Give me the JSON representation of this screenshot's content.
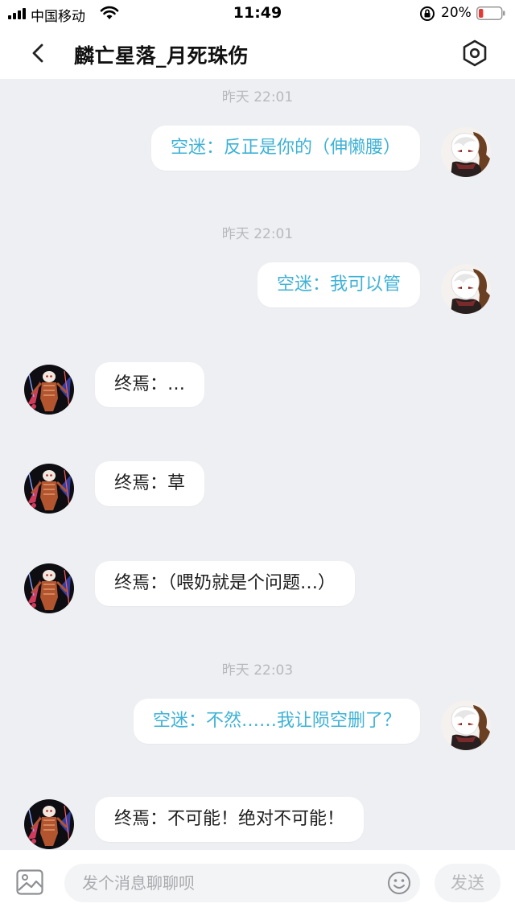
{
  "status_bar": {
    "carrier": "中国移动",
    "time": "11:49",
    "battery_percent": "20%",
    "battery_level": 0.2,
    "battery_color": "#e53935"
  },
  "nav": {
    "title": "麟亡星落_月死珠伤",
    "back_icon": "chevron-left-icon",
    "settings_icon": "hexagon-settings-icon"
  },
  "messages": [
    {
      "timestamp": "昨天 22:01",
      "side": "right",
      "text": "空迷：反正是你的（伸懒腰）"
    },
    {
      "timestamp": "昨天 22:01",
      "side": "right",
      "text": "空迷：我可以管"
    },
    {
      "timestamp": "",
      "side": "left",
      "text": "终焉：…"
    },
    {
      "timestamp": "",
      "side": "left",
      "text": "终焉：草"
    },
    {
      "timestamp": "",
      "side": "left",
      "text": "终焉：（喂奶就是个问题…）"
    },
    {
      "timestamp": "昨天 22:03",
      "side": "right",
      "text": "空迷：不然……我让陨空删了？"
    },
    {
      "timestamp": "",
      "side": "left",
      "text": "终焉：不可能！绝对不可能！"
    }
  ],
  "input_bar": {
    "placeholder": "发个消息聊聊呗",
    "send_label": "发送",
    "image_icon": "image-icon",
    "emoji_icon": "smiley-icon"
  },
  "colors": {
    "my_text": "#3fb2d6",
    "their_text": "#1e1e1e",
    "background": "#eeeff3",
    "timestamp": "#b8b9bd"
  }
}
